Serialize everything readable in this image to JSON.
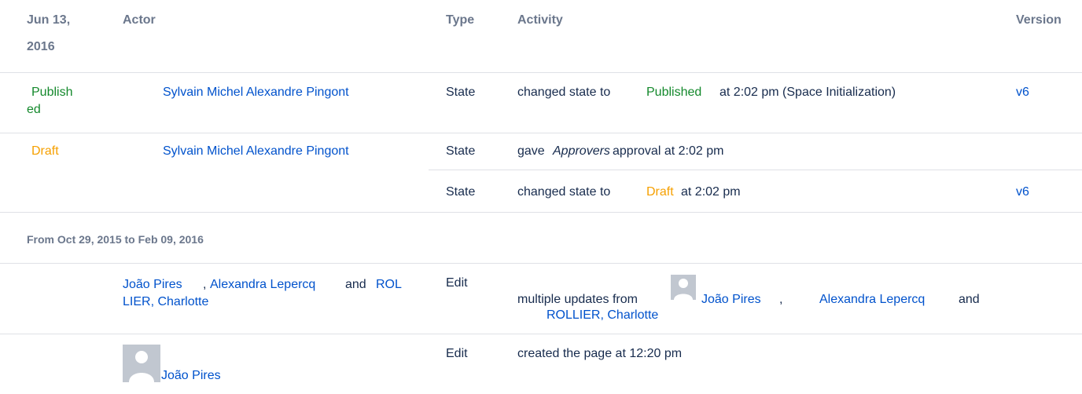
{
  "header": {
    "date_line1": "Jun 13,",
    "date_line2": "2016",
    "actor": "Actor",
    "type": "Type",
    "activity": "Activity",
    "version": "Version"
  },
  "row_published": {
    "status_line1": "Publish",
    "status_line2": "ed",
    "actor": "Sylvain Michel Alexandre Pingont",
    "type": "State",
    "activity_prefix": "changed state to",
    "activity_state": "Published",
    "activity_suffix": "at 2:02 pm (Space Initialization)",
    "version": "v6"
  },
  "row_draft": {
    "status": "Draft",
    "actor": "Sylvain Michel Alexandre Pingont",
    "type": "State",
    "activity_prefix": "gave",
    "activity_italic": "Approvers",
    "activity_suffix": "approval at 2:02 pm"
  },
  "row_draft_sub": {
    "type": "State",
    "activity_prefix": "changed state to",
    "activity_state": "Draft",
    "activity_suffix": "at 2:02 pm",
    "version": "v6"
  },
  "group2": {
    "label": "From Oct 29, 2015 to Feb 09, 2016"
  },
  "row_edit_multi": {
    "actor_1": "João Pires",
    "sep_1": ",",
    "actor_2": "Alexandra Lepercq",
    "and": "and",
    "actor_3_line1": "ROL",
    "actor_3_line2": "LIER, Charlotte",
    "type": "Edit",
    "activity_prefix": "multiple updates from",
    "activity_actor_1": "João Pires",
    "activity_sep": ",",
    "activity_actor_2": "Alexandra Lepercq",
    "activity_and": "and",
    "activity_actor_3": "ROLLIER, Charlotte"
  },
  "row_created": {
    "actor": "João Pires",
    "type": "Edit",
    "activity": "created the page at 12:20 pm"
  },
  "colors": {
    "link": "#0052cc",
    "published": "#14892c",
    "draft": "#f6a000",
    "header": "#6b778c",
    "divider": "#dfe1e6"
  }
}
